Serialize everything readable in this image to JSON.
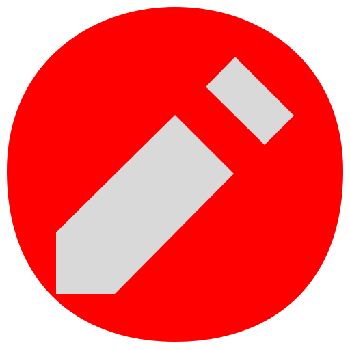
{
  "icon": {
    "name": "pencil-edit-icon",
    "background_color": "#ff0000",
    "glyph_color": "#d9d9d9"
  }
}
